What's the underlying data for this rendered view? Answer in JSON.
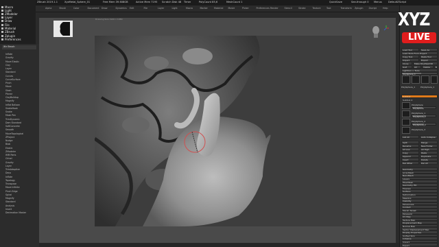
{
  "titlebar": {
    "app_title": "ZBrush 2019.1.1",
    "project": "XyzMetal_Sphere_01",
    "mem": "Free Mem 39.608GB",
    "active_mem": "Active Mem 7195",
    "scratch": "Scratch Disk 48",
    "timer": "Timer",
    "poly": "PolyCount 85,6",
    "mesh": "MeshCount 1",
    "quicksave": "QuickSave",
    "see_through": "See-through 0",
    "menus": "Menus",
    "default_script": "DefaultZScript"
  },
  "left_menu": [
    {
      "label": "Macro"
    },
    {
      "label": "Light"
    },
    {
      "label": "ZModeler"
    },
    {
      "label": "Layer"
    },
    {
      "label": "Draw"
    },
    {
      "label": "File"
    },
    {
      "label": "Material"
    },
    {
      "label": "ZBrush"
    },
    {
      "label": "Zplugin"
    },
    {
      "label": "Preferences"
    }
  ],
  "brush_panel": {
    "header": "Xtr Brush",
    "items": [
      "Inflate",
      "Gravity",
      "Move Elastic",
      "Clay",
      "Layer",
      "Standard",
      "Curves",
      "CurveSurface",
      "Pinch",
      "Move",
      "Slash",
      "Planar",
      "ClayBuildup",
      "Magnify",
      "Inflat Balloon",
      "SnakeHook",
      "Snake",
      "Mask Pen",
      "TrimDynamic",
      "Dam Standard",
      "SoftConcrete",
      "Smooth",
      "MoveTopological",
      "ZProject",
      "Nudge",
      "Blob",
      "Elastic",
      "ZModeler",
      "IMM Parts",
      "Chisel",
      "Gravity",
      "Layer",
      "TrimAdaptive",
      "Deco",
      "Inflate",
      "Topology",
      "Transpose",
      "Move Infinite",
      "Pinch Edge",
      "Spiral",
      "Magnify",
      "Standard",
      "Analysis",
      "Insert",
      "Decimation Master"
    ]
  },
  "tool_row": [
    "Alpha",
    "Brush",
    "Color",
    "Document",
    "Draw",
    "Dynamics",
    "Edit",
    "File",
    "Layer",
    "Light",
    "Macro",
    "Marker",
    "Material",
    "Movie",
    "Picker",
    "Preferences",
    "Render",
    "Stencil",
    "Stroke",
    "Texture",
    "Tool",
    "Transform",
    "Zplugin",
    "Zscript",
    "Help"
  ],
  "canvas_header": "Drawing Size 1920 x 1080",
  "right_panel": {
    "load_tool": "Load Tool",
    "save_as": "Save As",
    "load_from_project": "Load Tools From Project",
    "copy_tool": "Copy Tool",
    "paste_tool": "Paste Tool",
    "import": "Import",
    "export": "Export",
    "clone": "Clone",
    "make_polymesh": "Make PolyMesh3D",
    "goz": "GoZ",
    "all": "All",
    "visible": "Visible",
    "r": "R",
    "lightbox_tools": "Lightbox > Tools",
    "polysphere": "PolySphere_1",
    "subtool": "Subtool",
    "subtool_label": "Subtool 4",
    "poly_1": "PolySphere",
    "poly_2": "PolySphere_1",
    "poly_3": "PolySphere_2",
    "poly_4": "PolySphere_3",
    "list_all": "List All",
    "auto_collapse": "Auto Collapse",
    "split": "Split",
    "merge": "Merge",
    "rename": "Rename",
    "new_folder": "New Folder",
    "all_low": "All Low",
    "all_high": "All High",
    "copy": "Copy",
    "paste": "Paste",
    "append": "Append",
    "duplicate": "Duplicate",
    "insert": "Insert",
    "delete": "Delete",
    "del_other": "Del Other",
    "del_all": "Del All",
    "geometry": "Geometry",
    "array_mesh": "ArrayMesh",
    "nano_mesh": "NanoMesh",
    "layers": "Layers",
    "fiber_mesh": "FiberMesh",
    "geometry_hd": "Geometry HD",
    "preview": "Preview",
    "surface": "Surface",
    "deformation": "Deformation",
    "masking": "Masking",
    "visibility": "Visibility",
    "polygroups": "Polygroups",
    "contact": "Contact",
    "morph_target": "Morph Target",
    "polypaint": "Polypaint",
    "uv_map": "UV Map",
    "texture_map": "Texture Map",
    "displacement_map": "Displacement Map",
    "normal_map": "Normal Map",
    "vector_displacement": "Vector Displacement Map",
    "display_properties": "Display Properties",
    "unified_skin": "Unified Skin",
    "initialize": "Initialize",
    "import_tab": "Import",
    "export_tab": "Export",
    "slider_values": {
      "s1": 0.55,
      "s2": 0.45,
      "s3": 0.6,
      "s4": 0.5
    }
  },
  "logo": {
    "xyz": "XYZ",
    "live": "LIVE"
  },
  "colors": {
    "accent": "#e07a1a",
    "live_red": "#e01d1d",
    "canvas": "#4a4a4a"
  }
}
